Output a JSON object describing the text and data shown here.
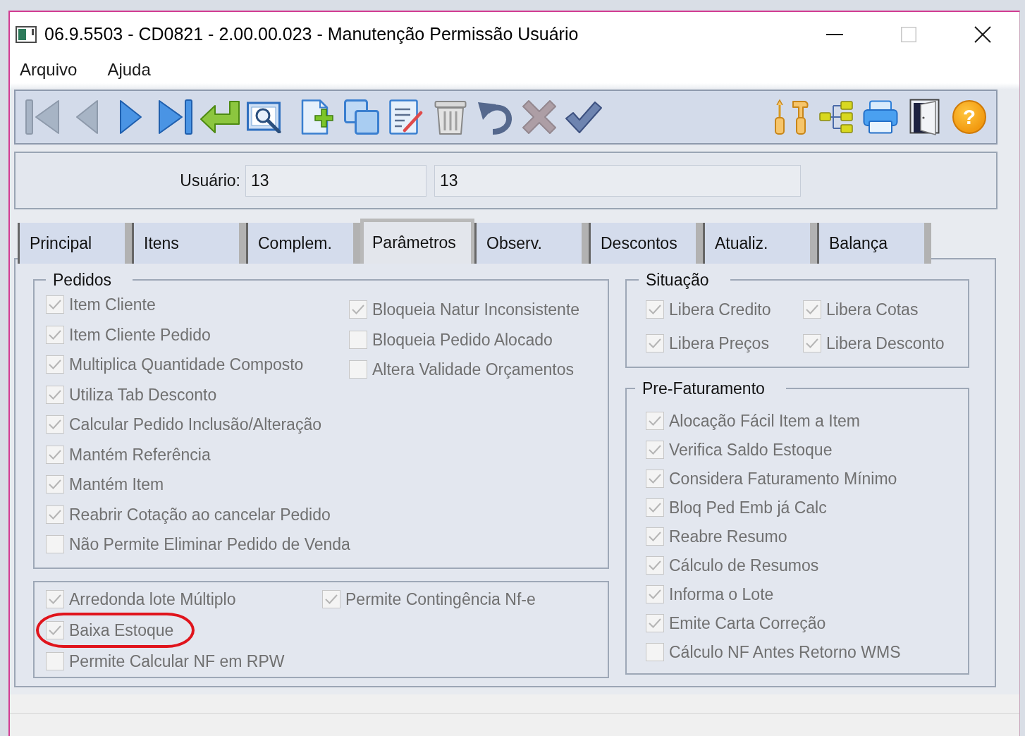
{
  "window": {
    "title": "06.9.5503 - CD0821 - 2.00.00.023 - Manutenção Permissão Usuário",
    "controls": [
      {
        "kind": "minimize",
        "disabled": false
      },
      {
        "kind": "maximize",
        "disabled": true
      },
      {
        "kind": "close",
        "disabled": false
      }
    ]
  },
  "menu": [
    {
      "label": "Arquivo"
    },
    {
      "label": "Ajuda"
    }
  ],
  "toolbar": {
    "left": [
      [
        {
          "kind": "first",
          "disabled": true
        },
        {
          "kind": "previous",
          "disabled": true
        },
        {
          "kind": "next",
          "disabled": false
        },
        {
          "kind": "last",
          "disabled": false
        },
        {
          "kind": "enter",
          "disabled": false
        },
        {
          "kind": "zoom",
          "disabled": false
        }
      ],
      [
        {
          "kind": "new",
          "disabled": false
        },
        {
          "kind": "copy",
          "disabled": false
        },
        {
          "kind": "edit",
          "disabled": false
        },
        {
          "kind": "delete",
          "disabled": false
        },
        {
          "kind": "undo",
          "disabled": false
        },
        {
          "kind": "cancel",
          "disabled": true
        },
        {
          "kind": "save",
          "disabled": false
        }
      ]
    ],
    "right": [
      {
        "kind": "tools",
        "disabled": false
      },
      {
        "kind": "tree",
        "disabled": false
      },
      {
        "kind": "print",
        "disabled": false
      },
      {
        "kind": "exit",
        "disabled": false
      },
      {
        "kind": "help",
        "disabled": false,
        "glyph": "?"
      }
    ]
  },
  "user": {
    "label": "Usuário:",
    "fields": [
      {
        "value": "13"
      },
      {
        "value": "13"
      }
    ]
  },
  "tabs": [
    {
      "label": "Principal",
      "selected": false
    },
    {
      "label": "Itens",
      "selected": false
    },
    {
      "label": "Complem.",
      "selected": false
    },
    {
      "label": "Parâmetros",
      "selected": true
    },
    {
      "label": "Observ.",
      "selected": false
    },
    {
      "label": "Descontos",
      "selected": false
    },
    {
      "label": "Atualiz.",
      "selected": false
    },
    {
      "label": "Balança",
      "selected": false
    }
  ],
  "panel": {
    "left": [
      {
        "title": "Pedidos",
        "columns": [
          [
            {
              "label": "Item Cliente",
              "checked": true,
              "disabled": true
            },
            {
              "label": "Item Cliente Pedido",
              "checked": true,
              "disabled": true
            },
            {
              "label": "Multiplica Quantidade Composto",
              "checked": true,
              "disabled": true
            },
            {
              "label": "Utiliza Tab Desconto",
              "checked": true,
              "disabled": true
            },
            {
              "label": "Calcular Pedido Inclusão/Alteração",
              "checked": true,
              "disabled": true
            },
            {
              "label": "Mantém Referência",
              "checked": true,
              "disabled": true
            },
            {
              "label": "Mantém Item",
              "checked": true,
              "disabled": true
            },
            {
              "label": "Reabrir Cotação ao cancelar Pedido",
              "checked": true,
              "disabled": true
            },
            {
              "label": "Não Permite Eliminar Pedido de Venda",
              "checked": false,
              "disabled": true
            }
          ],
          [
            {
              "label": "Bloqueia Natur Inconsistente",
              "checked": true,
              "disabled": true
            },
            {
              "label": "Bloqueia Pedido Alocado",
              "checked": false,
              "disabled": true
            },
            {
              "label": "Altera Validade Orçamentos",
              "checked": false,
              "disabled": true
            }
          ]
        ]
      },
      {
        "columns": [
          [
            {
              "label": "Arredonda lote Múltiplo",
              "checked": true,
              "disabled": true,
              "circled": false
            },
            {
              "label": "Baixa Estoque",
              "checked": true,
              "disabled": true,
              "circled": true
            },
            {
              "label": "Permite Calcular NF em RPW",
              "checked": false,
              "disabled": true,
              "circled": false
            }
          ],
          [
            {
              "label": "Permite Contingência Nf-e",
              "checked": true,
              "disabled": true,
              "circled": false
            }
          ]
        ]
      }
    ],
    "right": [
      {
        "title": "Situação",
        "columns": [
          [
            {
              "label": "Libera Credito",
              "checked": true,
              "disabled": true
            },
            {
              "label": "Libera Preços",
              "checked": true,
              "disabled": true
            }
          ],
          [
            {
              "label": "Libera Cotas",
              "checked": true,
              "disabled": true
            },
            {
              "label": "Libera Desconto",
              "checked": true,
              "disabled": true
            }
          ]
        ]
      },
      {
        "title": "Pre-Faturamento",
        "columns": [
          [
            {
              "label": "Alocação Fácil Item a Item",
              "checked": true,
              "disabled": true
            },
            {
              "label": "Verifica Saldo Estoque",
              "checked": true,
              "disabled": true
            },
            {
              "label": "Considera Faturamento Mínimo",
              "checked": true,
              "disabled": true
            },
            {
              "label": "Bloq Ped Emb já Calc",
              "checked": true,
              "disabled": true
            },
            {
              "label": "Reabre Resumo",
              "checked": true,
              "disabled": true
            },
            {
              "label": "Cálculo de Resumos",
              "checked": true,
              "disabled": true
            },
            {
              "label": "Informa o Lote",
              "checked": true,
              "disabled": true
            },
            {
              "label": "Emite Carta Correção",
              "checked": true,
              "disabled": true
            },
            {
              "label": "Cálculo NF Antes Retorno WMS",
              "checked": false,
              "disabled": true
            }
          ]
        ]
      }
    ]
  }
}
